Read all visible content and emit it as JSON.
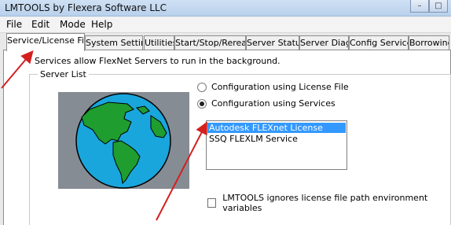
{
  "window": {
    "title": "LMTOOLS by Flexera Software LLC"
  },
  "menu": [
    "File",
    "Edit",
    "Mode",
    "Help"
  ],
  "tabs": [
    "Service/License File",
    "System Settings",
    "Utilities",
    "Start/Stop/Reread",
    "Server Status",
    "Server Diags",
    "Config Services",
    "Borrowing"
  ],
  "active_tab": "Service/License File",
  "description": "Services allow FlexNet Servers to run in the background.",
  "server_list": {
    "label": "Server List",
    "radio_license_file": "Configuration using License File",
    "radio_services": "Configuration using Services",
    "selected_radio": "Configuration using Services",
    "services": [
      "Autodesk FLEXnet License Server",
      "SSQ FLEXLM Service"
    ],
    "selected_service": "Autodesk FLEXnet License Server",
    "checkbox_label": "LMTOOLS ignores license file path environment variables",
    "checkbox_checked": false
  },
  "colors": {
    "annotation_arrow": "#d42020",
    "selection": "#3399ff",
    "globe_ocean": "#19a6dd",
    "globe_land": "#1f9d2f",
    "globe_background": "#868c93"
  },
  "icons": {
    "globe": "earth-globe-icon",
    "minimize": "minimize-icon",
    "maximize": "maximize-icon"
  }
}
